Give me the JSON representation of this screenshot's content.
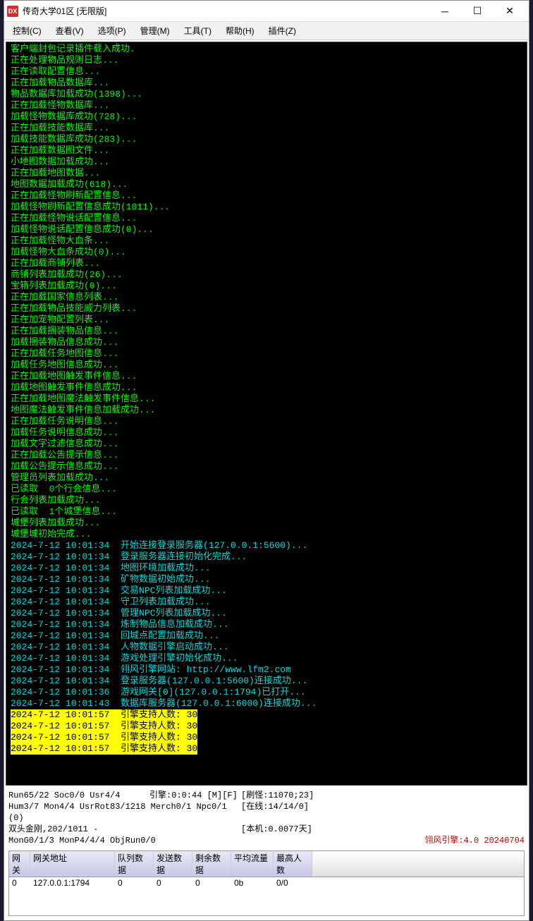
{
  "window": {
    "title": "传奇大学01区  [无限版]",
    "icon_text": "DX"
  },
  "menus": {
    "control": "控制(C)",
    "view": "查看(V)",
    "options": "选项(P)",
    "manage": "管理(M)",
    "tools": "工具(T)",
    "help": "帮助(H)",
    "plugins": "插件(Z)"
  },
  "logs": [
    {
      "t": "客户端封包记录插件载入成功.",
      "c": "g"
    },
    {
      "t": "正在处理物品规则日志...",
      "c": "g"
    },
    {
      "t": "正在读取配置信息...",
      "c": "g"
    },
    {
      "t": "正在加载物品数据库...",
      "c": "g"
    },
    {
      "t": "物品数据库加载成功(1398)...",
      "c": "g"
    },
    {
      "t": "正在加载怪物数据库...",
      "c": "g"
    },
    {
      "t": "加载怪物数据库成功(728)...",
      "c": "g"
    },
    {
      "t": "正在加载技能数据库...",
      "c": "g"
    },
    {
      "t": "加载技能数据库成功(283)...",
      "c": "g"
    },
    {
      "t": "正在加载数据图文件...",
      "c": "g"
    },
    {
      "t": "小地图数据加载成功...",
      "c": "g"
    },
    {
      "t": "正在加载地图数据...",
      "c": "g"
    },
    {
      "t": "地图数据加载成功(618)...",
      "c": "g"
    },
    {
      "t": "正在加载怪物刷新配置信息...",
      "c": "g"
    },
    {
      "t": "加载怪物刷新配置信息成功(1011)...",
      "c": "g"
    },
    {
      "t": "正在加载怪物说话配置信息...",
      "c": "g"
    },
    {
      "t": "加载怪物说话配置信息成功(0)...",
      "c": "g"
    },
    {
      "t": "正在加载怪物大血条...",
      "c": "g"
    },
    {
      "t": "加载怪物大血条成功(0)...",
      "c": "g"
    },
    {
      "t": "正在加载商铺列表...",
      "c": "g"
    },
    {
      "t": "商铺列表加载成功(26)...",
      "c": "g"
    },
    {
      "t": "宝箱列表加载成功(0)...",
      "c": "g"
    },
    {
      "t": "正在加载国家信息列表...",
      "c": "g"
    },
    {
      "t": "正在加载物品技能威力列表...",
      "c": "g"
    },
    {
      "t": "正在加宠物配置列表...",
      "c": "g"
    },
    {
      "t": "正在加载捆装物品信息...",
      "c": "g"
    },
    {
      "t": "加载捆装物品信息成功...",
      "c": "g"
    },
    {
      "t": "正在加载任务地图信息...",
      "c": "g"
    },
    {
      "t": "加载任务地图信息成功...",
      "c": "g"
    },
    {
      "t": "正在加载地图触发事件信息...",
      "c": "g"
    },
    {
      "t": "加载地图触发事件信息成功...",
      "c": "g"
    },
    {
      "t": "正在加载地图魔法触发事件信息...",
      "c": "g"
    },
    {
      "t": "地图魔法触发事件信息加载成功...",
      "c": "g"
    },
    {
      "t": "正在加载任务说明信息...",
      "c": "g"
    },
    {
      "t": "加载任务说明信息成功...",
      "c": "g"
    },
    {
      "t": "加载文字过滤信息成功...",
      "c": "g"
    },
    {
      "t": "正在加载公告提示信息...",
      "c": "g"
    },
    {
      "t": "加载公告提示信息成功...",
      "c": "g"
    },
    {
      "t": "管理员列表加载成功...",
      "c": "g"
    },
    {
      "t": "已读取  0个行会信息...",
      "c": "g"
    },
    {
      "t": "行会列表加载成功...",
      "c": "g"
    },
    {
      "t": "已读取  1个城堡信息...",
      "c": "g"
    },
    {
      "t": "城堡列表加载成功...",
      "c": "g"
    },
    {
      "t": "城堡城初始完成...",
      "c": "g"
    },
    {
      "t": "2024-7-12 10:01:34  开始连接登录服务器(127.0.0.1:5600)...",
      "c": "c"
    },
    {
      "t": "2024-7-12 10:01:34  登录服务器连接初始化完成...",
      "c": "c"
    },
    {
      "t": "2024-7-12 10:01:34  地图环境加载成功...",
      "c": "c"
    },
    {
      "t": "2024-7-12 10:01:34  矿物数据初始成功...",
      "c": "c"
    },
    {
      "t": "2024-7-12 10:01:34  交易NPC列表加载成功...",
      "c": "c"
    },
    {
      "t": "2024-7-12 10:01:34  守卫列表加载成功...",
      "c": "c"
    },
    {
      "t": "2024-7-12 10:01:34  管理NPC列表加载成功...",
      "c": "c"
    },
    {
      "t": "2024-7-12 10:01:34  炼制物品信息加载成功...",
      "c": "c"
    },
    {
      "t": "2024-7-12 10:01:34  回城点配置加载成功...",
      "c": "c"
    },
    {
      "t": "2024-7-12 10:01:34  人物数据引擎启动成功...",
      "c": "c"
    },
    {
      "t": "2024-7-12 10:01:34  游戏处理引擎初始化成功...",
      "c": "c"
    },
    {
      "t": "2024-7-12 10:01:34  翎风引擎网站: http://www.lfm2.com",
      "c": "c"
    },
    {
      "t": "2024-7-12 10:01:34  登录服务器(127.0.0.1:5600)连接成功...",
      "c": "c"
    },
    {
      "t": "2024-7-12 10:01:36  游戏网关[0](127.0.0.1:1794)已打开...",
      "c": "c"
    },
    {
      "t": "2024-7-12 10:01:43  数据库服务器(127.0.0.1:6000)连接成功...",
      "c": "c"
    },
    {
      "t": "2024-7-12 10:01:57  引擎支持人数: 30",
      "c": "hl"
    },
    {
      "t": "2024-7-12 10:01:57  引擎支持人数: 30",
      "c": "hl"
    },
    {
      "t": "2024-7-12 10:01:57  引擎支持人数: 30",
      "c": "hl"
    },
    {
      "t": "2024-7-12 10:01:57  引擎支持人数: 30",
      "c": "hl"
    }
  ],
  "status": {
    "r1_left": "Run65/22 Soc0/0 Usr4/4",
    "r1_mid": "引擎:0:0:44 [M][F]",
    "r1_right": "[刷怪:11070;23]",
    "r2_left": "Hum3/7 Mon4/4 UsrRot83/1218 Merch0/1 Npc0/1 (0)",
    "r2_right": "[在线:14/14/0]",
    "r3_left": "双头金刚,202/1011 -",
    "r3_right": "[本机:0.0077天]",
    "r4_left": "MonG0/1/3 MonP4/4/4 ObjRun0/0",
    "engine_version": "翎风引擎:4.0 20240704"
  },
  "table": {
    "headers": {
      "gateway": "网关",
      "address": "网关地址",
      "queue": "队列数据",
      "send": "发送数据",
      "remain": "剩余数据",
      "avg": "平均流量",
      "max": "最高人数"
    },
    "row": {
      "gateway": "0",
      "address": "127.0.0.1:1794",
      "queue": "0",
      "send": "0",
      "remain": "0",
      "avg": "0b",
      "max": "0/0"
    }
  }
}
